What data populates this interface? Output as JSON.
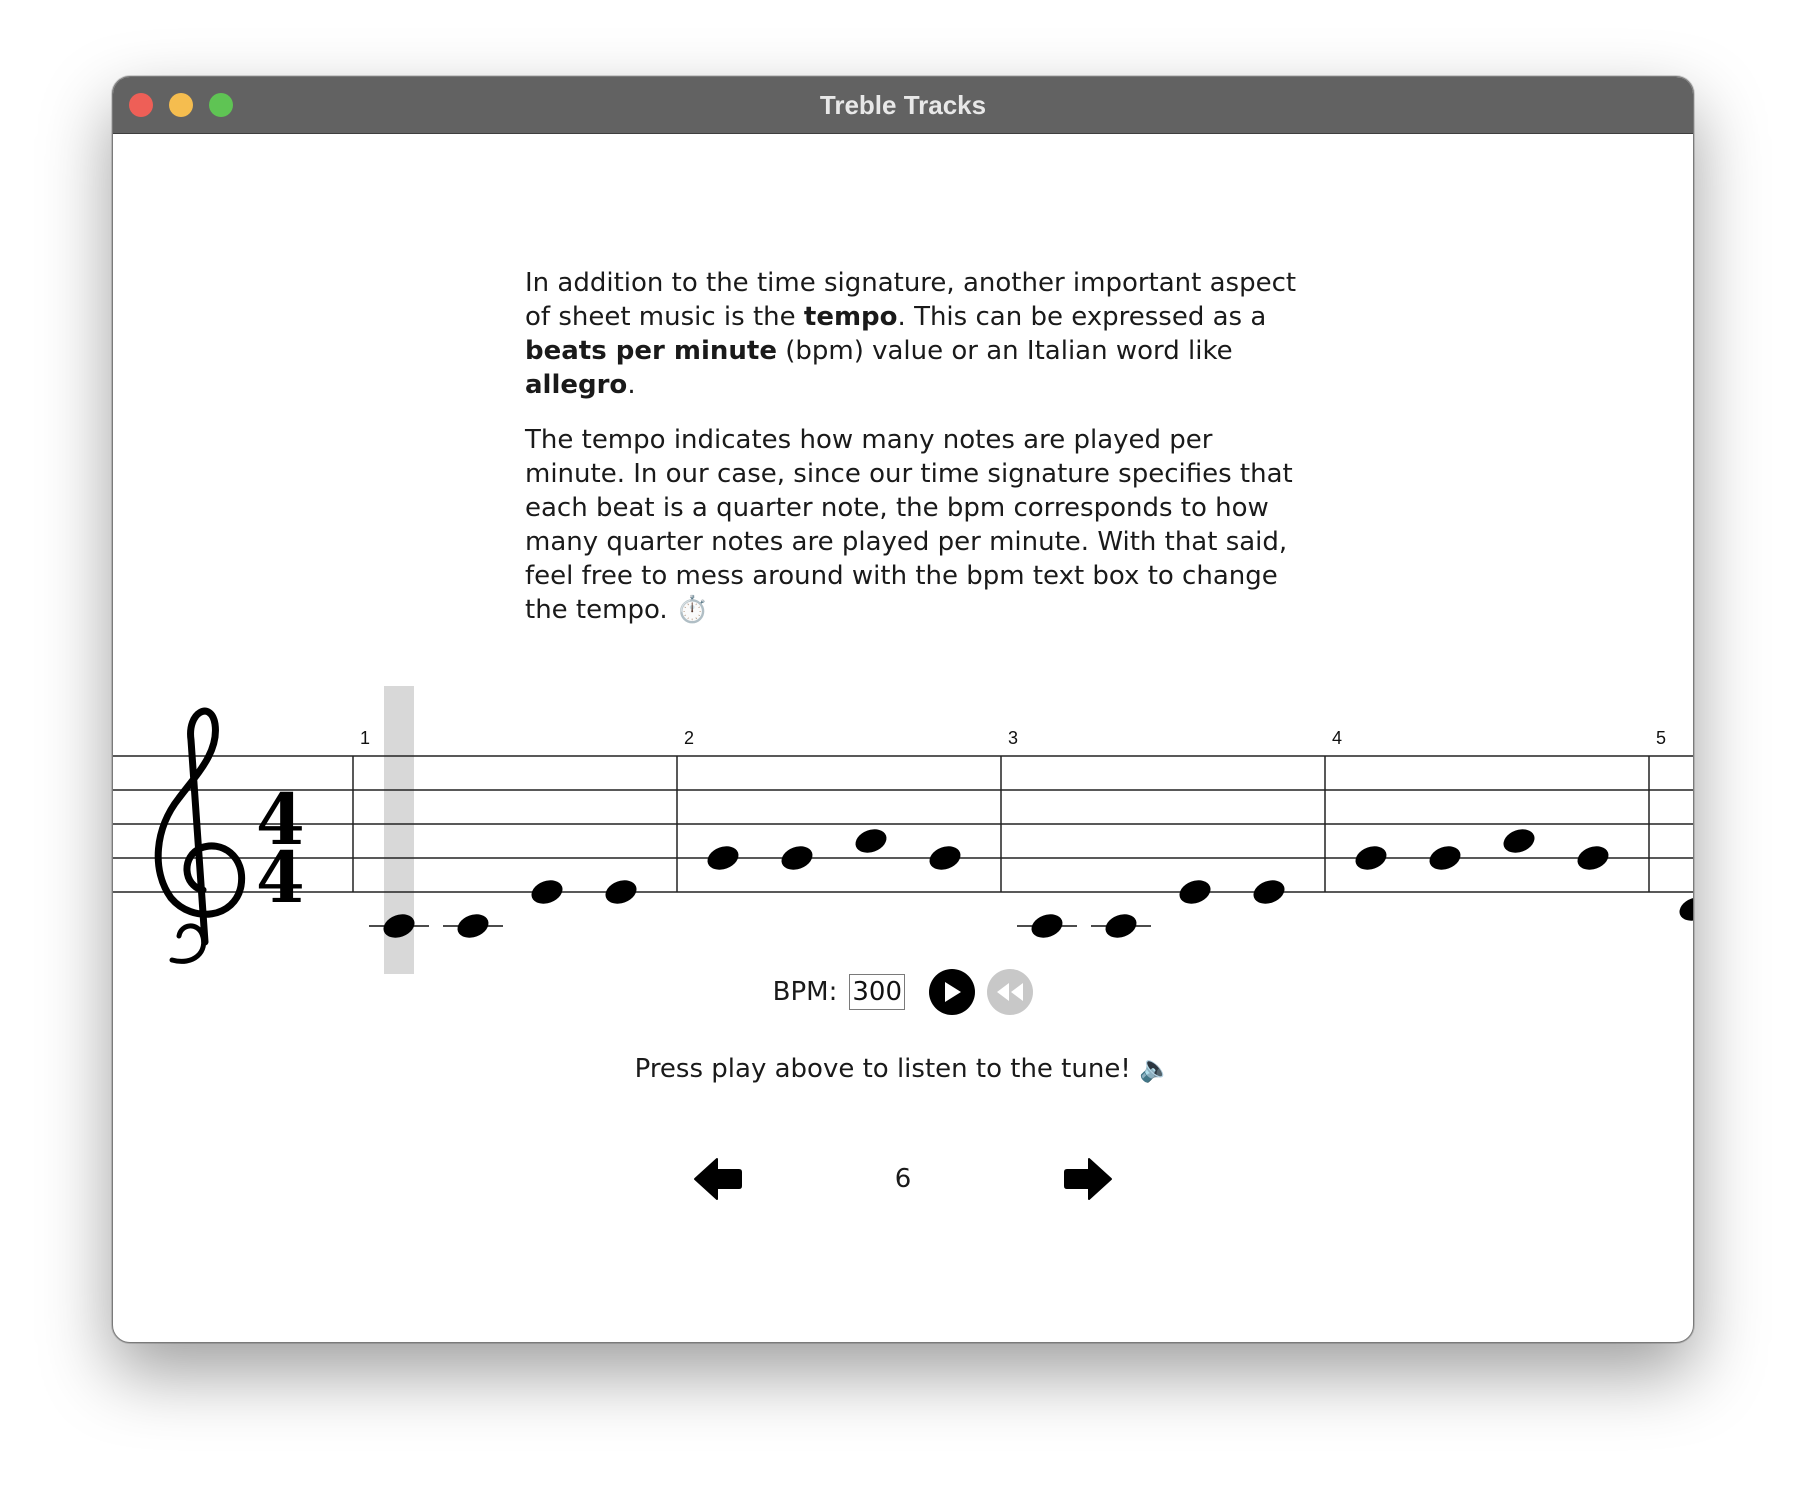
{
  "window": {
    "title": "Treble Tracks"
  },
  "explanation": {
    "p1": {
      "t1": "In addition to the time signature, another important aspect of sheet music is the ",
      "b1": "tempo",
      "t2": ". This can be expressed as a ",
      "b2": "beats per minute",
      "t3": " (bpm) value or an Italian word like ",
      "b3": "allegro",
      "t4": "."
    },
    "p2": "The tempo indicates how many notes are played per minute. In our case, since our time signature specifies that each beat is a quarter note, the bpm corresponds to how many quarter notes are played per minute. With that said, feel free to mess around with the bpm text box to change the tempo. ",
    "p2_emoji": "⏱️"
  },
  "sheet": {
    "clef": "treble-clef",
    "time_signature": {
      "top": "4",
      "bottom": "4"
    },
    "measure_numbers": [
      "1",
      "2",
      "3",
      "4",
      "5"
    ],
    "highlighted_beat": 1,
    "notes_by_measure": [
      [
        "C4",
        "C4",
        "E4",
        "E4"
      ],
      [
        "G4",
        "G4",
        "A4",
        "G4"
      ],
      [
        "C4",
        "C4",
        "E4",
        "E4"
      ],
      [
        "G4",
        "G4",
        "A4",
        "G4"
      ],
      [
        "D4"
      ]
    ]
  },
  "controls": {
    "bpm_label": "BPM:",
    "bpm_value": "300",
    "play_icon": "play-icon",
    "rewind_icon": "rewind-icon"
  },
  "hint": {
    "text": "Press play above to listen to the tune! ",
    "emoji": "🔈"
  },
  "pager": {
    "page": "6",
    "prev_icon": "arrow-left-icon",
    "next_icon": "arrow-right-icon"
  },
  "colors": {
    "titlebar": "#626262",
    "highlight": "#d8d8d8",
    "rewind_disabled": "#c8c8c8"
  }
}
